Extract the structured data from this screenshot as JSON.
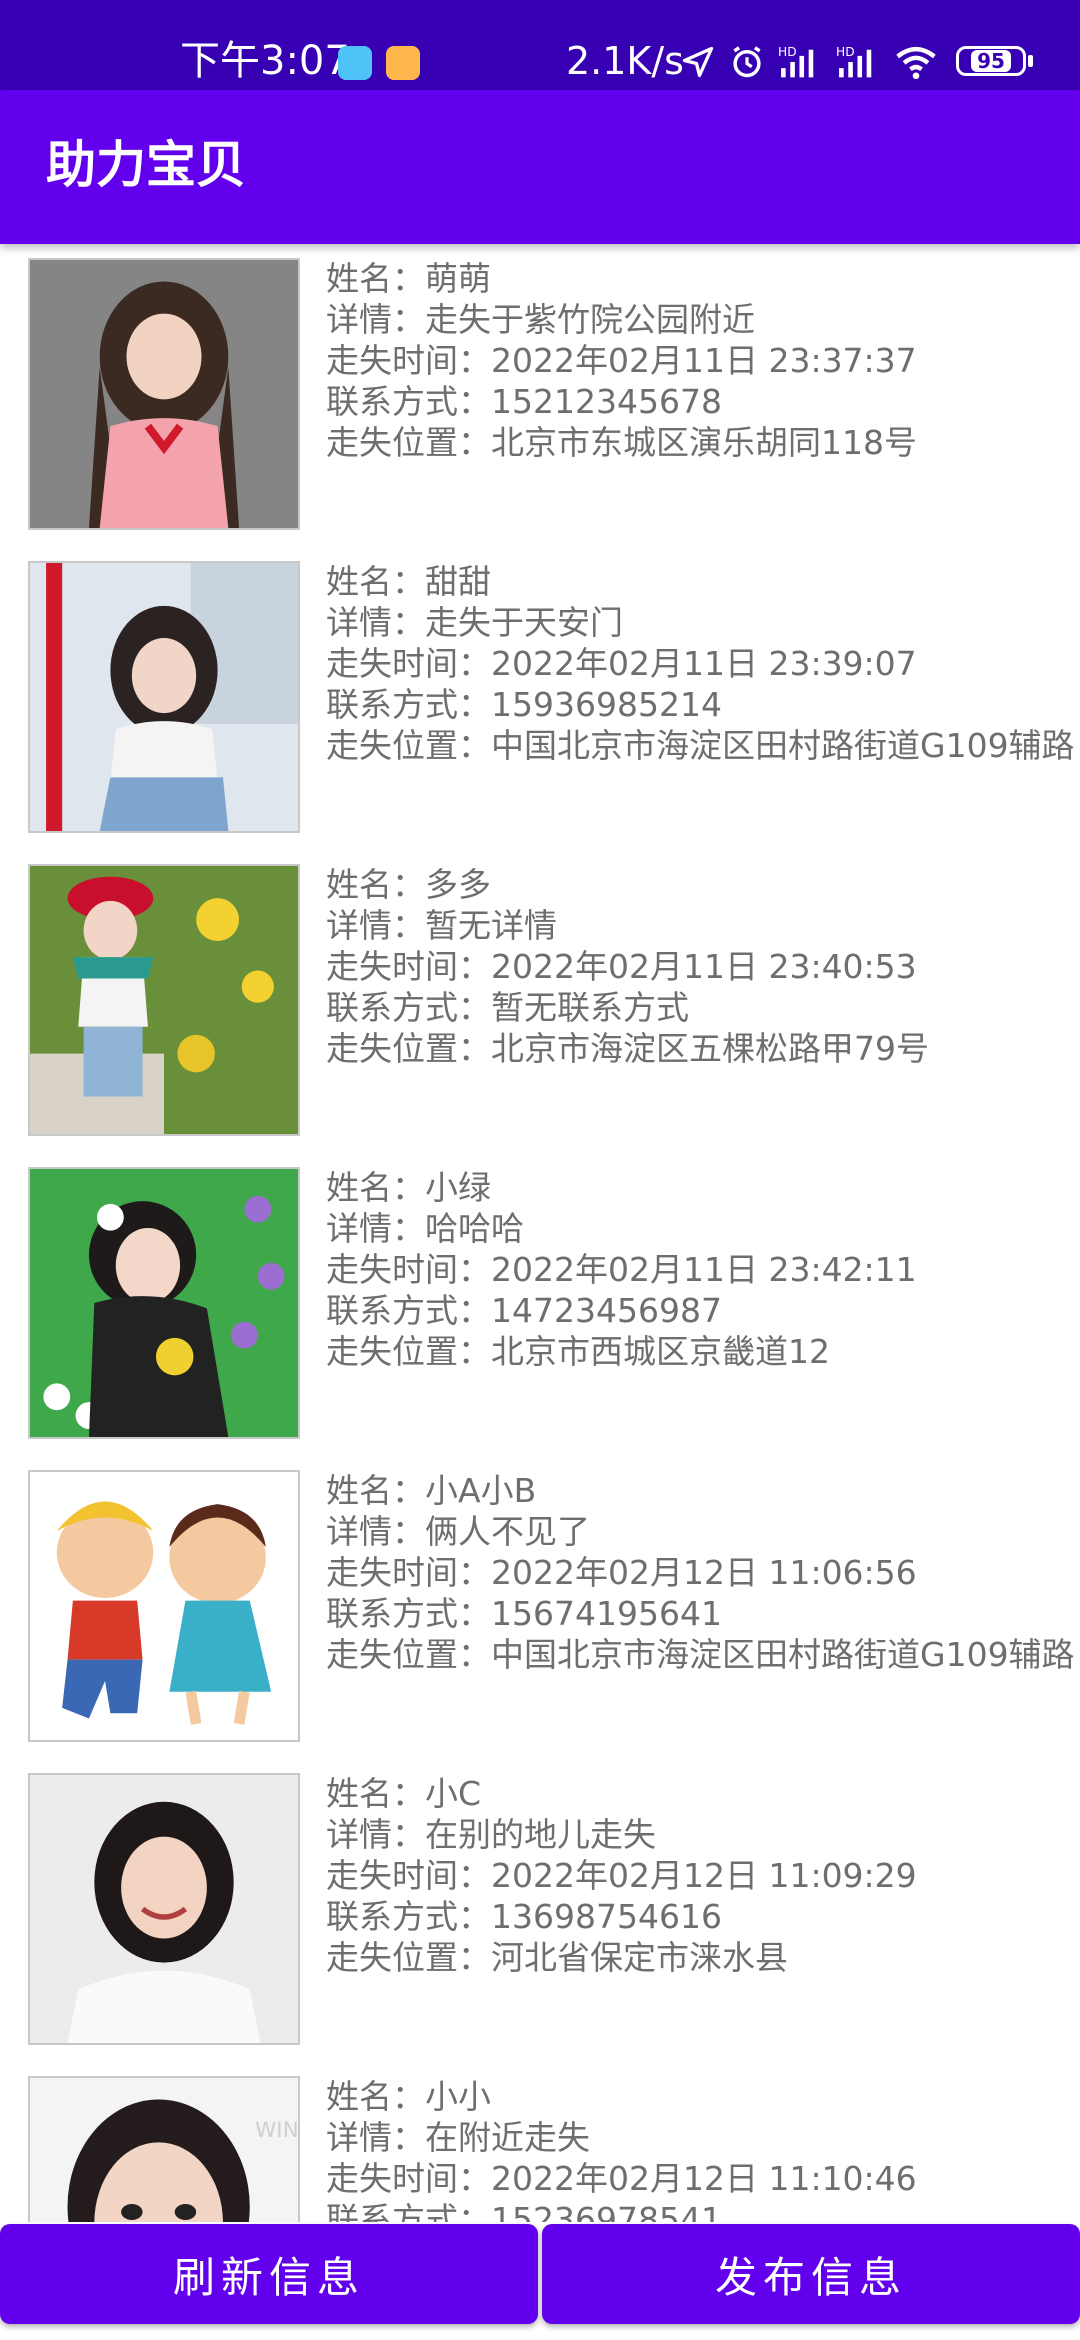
{
  "status_bar": {
    "time": "下午3:07",
    "net_speed": "2.1K/s",
    "battery": "95",
    "icons": [
      "telegram-icon",
      "message-icon",
      "location-arrow-icon",
      "alarm-icon",
      "signal-hd-icon",
      "signal-hd-icon",
      "wifi-icon",
      "battery-icon"
    ]
  },
  "app_bar": {
    "title": "助力宝贝"
  },
  "labels": {
    "name": "姓名：",
    "detail": "详情：",
    "time": "走失时间：",
    "contact": "联系方式：",
    "location": "走失位置："
  },
  "items": [
    {
      "name": "萌萌",
      "detail": "走失于紫竹院公园附近",
      "time": "2022年02月11日 23:37:37",
      "contact": "15212345678",
      "location": "北京市东城区演乐胡同118号"
    },
    {
      "name": "甜甜",
      "detail": "走失于天安门",
      "time": "2022年02月11日 23:39:07",
      "contact": "15936985214",
      "location": "中国北京市海淀区田村路街道G109辅路"
    },
    {
      "name": "多多",
      "detail": "暂无详情",
      "time": "2022年02月11日 23:40:53",
      "contact": "暂无联系方式",
      "location": "北京市海淀区五棵松路甲79号"
    },
    {
      "name": "小绿",
      "detail": "哈哈哈",
      "time": "2022年02月11日 23:42:11",
      "contact": "14723456987",
      "location": "北京市西城区京畿道12"
    },
    {
      "name": "小A小B",
      "detail": "俩人不见了",
      "time": "2022年02月12日 11:06:56",
      "contact": "15674195641",
      "location": "中国北京市海淀区田村路街道G109辅路"
    },
    {
      "name": "小C",
      "detail": "在别的地儿走失",
      "time": "2022年02月12日 11:09:29",
      "contact": "13698754616",
      "location": "河北省保定市涞水县"
    },
    {
      "name": "小小",
      "detail": "在附近走失",
      "time": "2022年02月12日 11:10:46",
      "contact": "15236978541",
      "location": ""
    }
  ],
  "buttons": {
    "refresh": "刷新信息",
    "publish": "发布信息"
  },
  "colors": {
    "primary": "#6200ee",
    "primary_dark": "#3700b3",
    "text": "#6e6e6e"
  }
}
